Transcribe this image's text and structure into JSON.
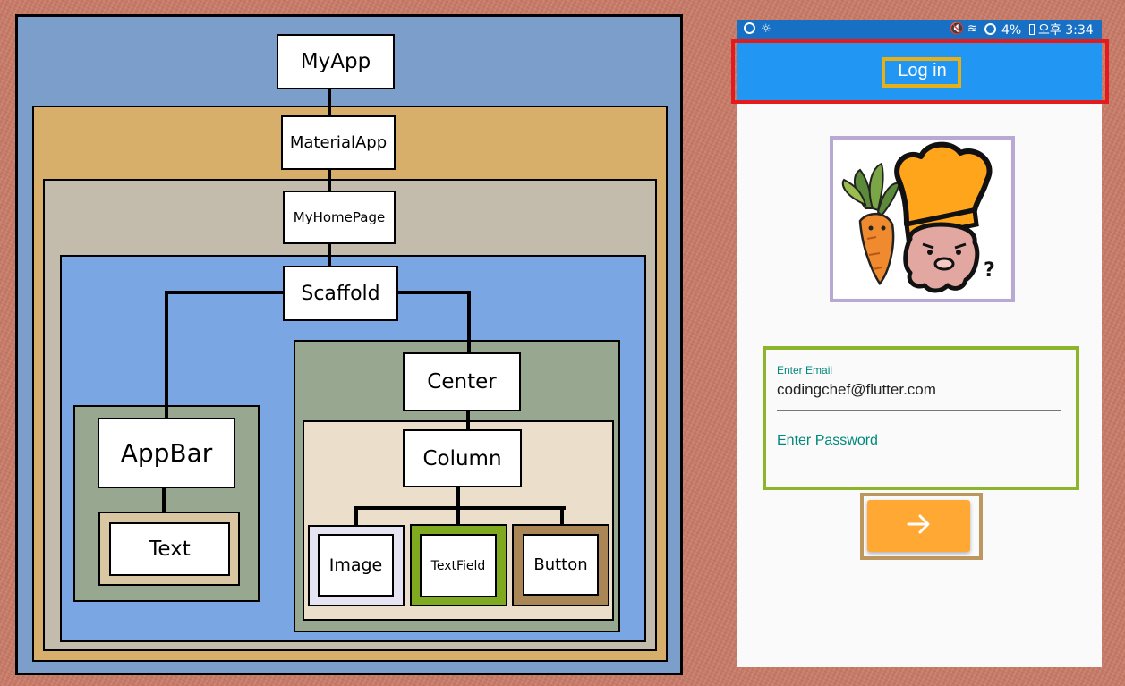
{
  "diagram": {
    "nodes": {
      "myapp": "MyApp",
      "materialapp": "MaterialApp",
      "myhomepage": "MyHomePage",
      "scaffold": "Scaffold",
      "appbar": "AppBar",
      "text": "Text",
      "center": "Center",
      "column": "Column",
      "image": "Image",
      "textfield": "TextField",
      "button": "Button"
    },
    "colors": {
      "myapp_box": "#7b9ecb",
      "materialapp_box": "#d8ae6b",
      "myhomepage_box": "#c3bcac",
      "scaffold_box": "#7aa7e3",
      "green_box": "#98a890",
      "column_box": "#ebdecb",
      "text_box": "#d9c7a3",
      "image_box": "#e6e4f3",
      "textfield_box": "#7faa1f",
      "button_box": "#aa8657"
    }
  },
  "phone": {
    "status": {
      "left_icons": [
        "sync-icon",
        "weather-icon"
      ],
      "right_icons": [
        "mute-icon",
        "wifi-icon",
        "blocked-icon"
      ],
      "battery": "4%",
      "time": "오후 3:34"
    },
    "appbar": {
      "title": "Log in",
      "color": "#2196f3"
    },
    "highlights": {
      "appbar": "#e21c1c",
      "title": "#e8b018",
      "image": "#b7a9d3",
      "fields": "#8db52c",
      "button": "#bc9860"
    },
    "email": {
      "label": "Enter Email",
      "value": "codingchef@flutter.com"
    },
    "password": {
      "label": "Enter Password",
      "value": ""
    },
    "submit": {
      "icon": "arrow-right-icon",
      "color": "#ffa834"
    }
  }
}
